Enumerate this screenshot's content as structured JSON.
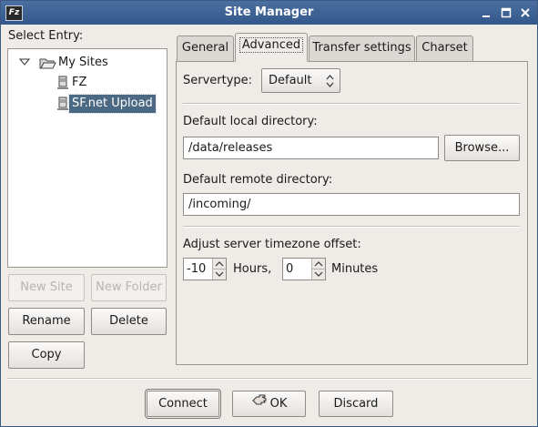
{
  "window": {
    "title": "Site Manager",
    "app_icon_label": "Fz",
    "controls": [
      "minimize-icon",
      "maximize-icon",
      "close-icon"
    ]
  },
  "left": {
    "select_entry_label": "Select Entry:",
    "tree": {
      "root": "My Sites",
      "items": [
        "FZ",
        "SF.net Upload"
      ],
      "selected": "SF.net Upload"
    },
    "buttons": {
      "new_site": "New Site",
      "new_folder": "New Folder",
      "rename": "Rename",
      "delete": "Delete",
      "copy": "Copy"
    }
  },
  "tabs": [
    "General",
    "Advanced",
    "Transfer settings",
    "Charset"
  ],
  "active_tab": "Advanced",
  "advanced": {
    "servertype_label": "Servertype:",
    "servertype_value": "Default",
    "local_dir_label": "Default local directory:",
    "local_dir_value": "/data/releases",
    "browse_button": "Browse...",
    "remote_dir_label": "Default remote directory:",
    "remote_dir_value": "/incoming/",
    "tz_label": "Adjust server timezone offset:",
    "tz_hours_value": "-10",
    "tz_hours_unit": "Hours,",
    "tz_minutes_value": "0",
    "tz_minutes_unit": "Minutes"
  },
  "footer": {
    "connect": "Connect",
    "ok": "OK",
    "discard": "Discard"
  },
  "colors": {
    "titlebar": "#33578a",
    "selection": "#4b6983",
    "window_bg": "#efebe7"
  }
}
